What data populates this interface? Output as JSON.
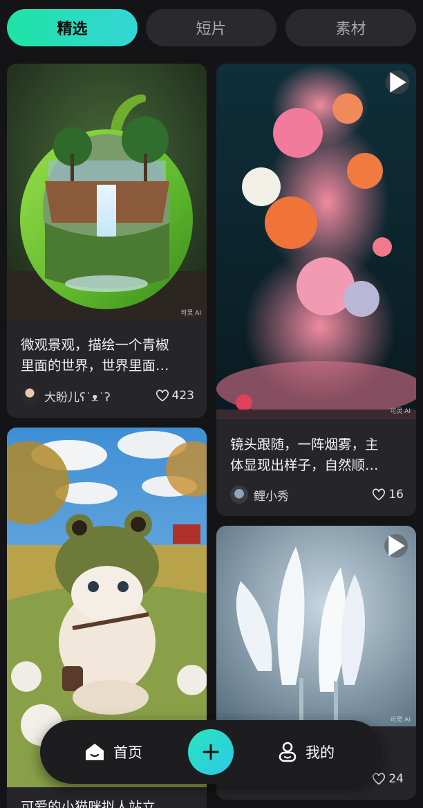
{
  "tabs": [
    {
      "label": "精选",
      "active": true
    },
    {
      "label": "短片",
      "active": false
    },
    {
      "label": "素材",
      "active": false
    }
  ],
  "cards": {
    "pepper": {
      "caption_line1": "微观景观，描绘一个青椒",
      "caption_line2": "里面的世界，世界里面…",
      "author": "大盼儿ʕ˙ᴥ˙ʔ",
      "likes": "423",
      "watermark": "可灵 AI"
    },
    "flowers": {
      "caption_line1": "镜头跟随，一阵烟雾，主",
      "caption_line2": "体显现出样子，自然顺…",
      "author": "鲤小秀",
      "likes": "16",
      "watermark": "可灵 AI",
      "has_play_icon": true
    },
    "kitten": {
      "caption_line1": "可爱的小猫咪拟人站立"
    },
    "lily": {
      "likes": "24",
      "watermark": "可灵 AI",
      "has_play_icon": true
    }
  },
  "bottom_nav": {
    "home_label": "首页",
    "mine_label": "我的",
    "create_icon": "plus-icon"
  },
  "colors": {
    "background": "#141416",
    "accent_gradient_start": "#1fe3a4",
    "accent_gradient_end": "#33d6d6",
    "tab_inactive": "#2a2a2e",
    "card_bg": "#26262a"
  }
}
